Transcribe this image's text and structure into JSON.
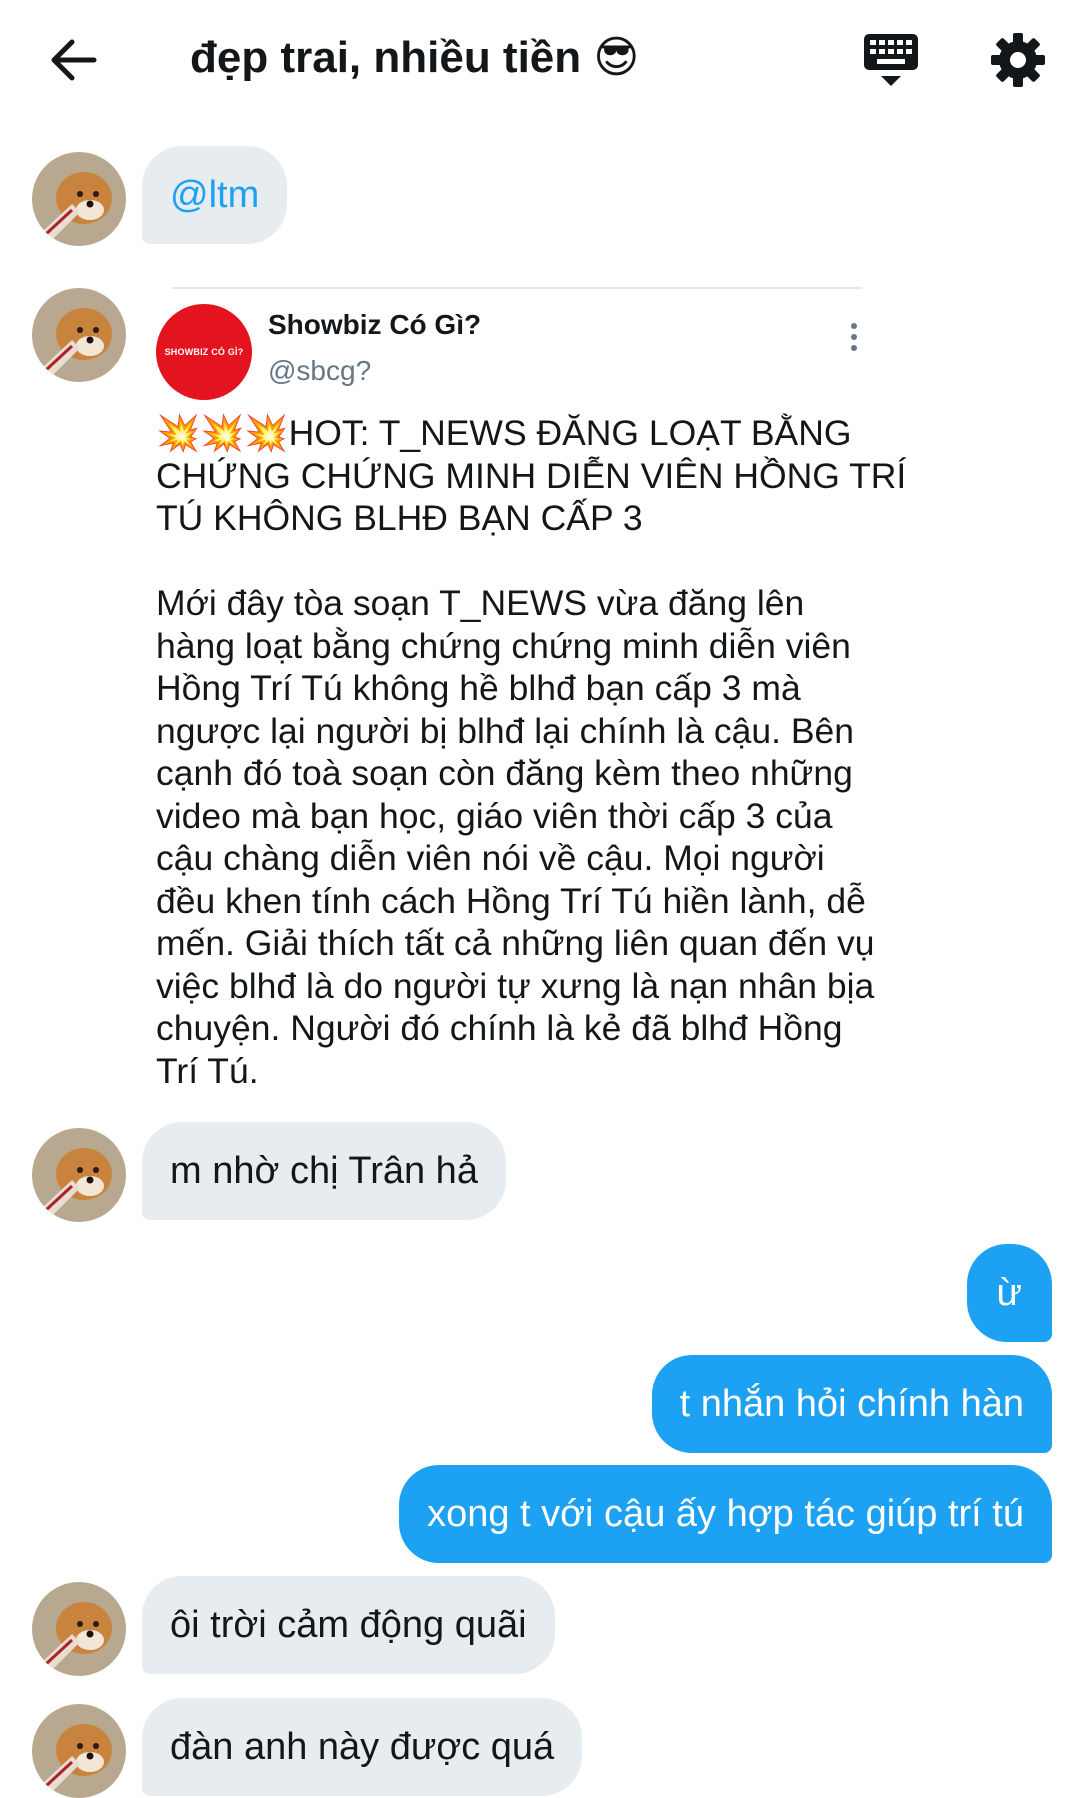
{
  "header": {
    "title": "đẹp trai, nhiều tiền",
    "title_emoji": "😎",
    "back_icon": "arrow-left-icon",
    "keyboard_icon": "keyboard-icon",
    "settings_icon": "gear-icon"
  },
  "messages": {
    "m1": "@ltm",
    "m3": "m nhờ chị Trân hả",
    "m4": "ừ",
    "m5": "t nhắn hỏi chính hàn",
    "m6": "xong t với cậu ấy hợp tác giúp trí tú",
    "m7": "ôi trời cảm động quãi",
    "m8": "đàn anh này được quá"
  },
  "tweet": {
    "logo_text": "SHOWBIZ CÓ GÌ?",
    "name": "Showbiz Có Gì?",
    "handle": "@sbcg?",
    "headline_lines": [
      "💥💥💥HOT: T_NEWS ĐĂNG LOẠT BẰNG",
      "CHỨNG CHỨNG MINH DIỄN VIÊN HỒNG TRÍ",
      "TÚ KHÔNG BLHĐ BẠN CẤP 3"
    ],
    "body_lines": [
      "Mới đây tòa soạn T_NEWS vừa đăng lên",
      "hàng loạt bằng chứng chứng minh diễn viên",
      "Hồng Trí Tú không hề blhđ bạn cấp 3 mà",
      "ngược lại người bị blhđ lại chính là cậu. Bên",
      "cạnh đó toà soạn còn đăng kèm theo những",
      "video mà bạn học, giáo viên thời cấp 3 của",
      "cậu chàng diễn viên nói về cậu. Mọi người",
      "đều khen tính cách Hồng Trí Tú hiền lành, dễ",
      "mến. Giải thích tất cả những liên quan đến vụ",
      "việc blhđ là do người tự xưng là nạn nhân bịa",
      "chuyện. Người đó chính là kẻ đã blhđ Hồng",
      "Trí Tú."
    ]
  },
  "colors": {
    "outgoing_bubble": "#1da1f2",
    "incoming_bubble": "#e6ecf0",
    "tweet_logo": "#e3141f",
    "handle_gray": "#657786"
  }
}
